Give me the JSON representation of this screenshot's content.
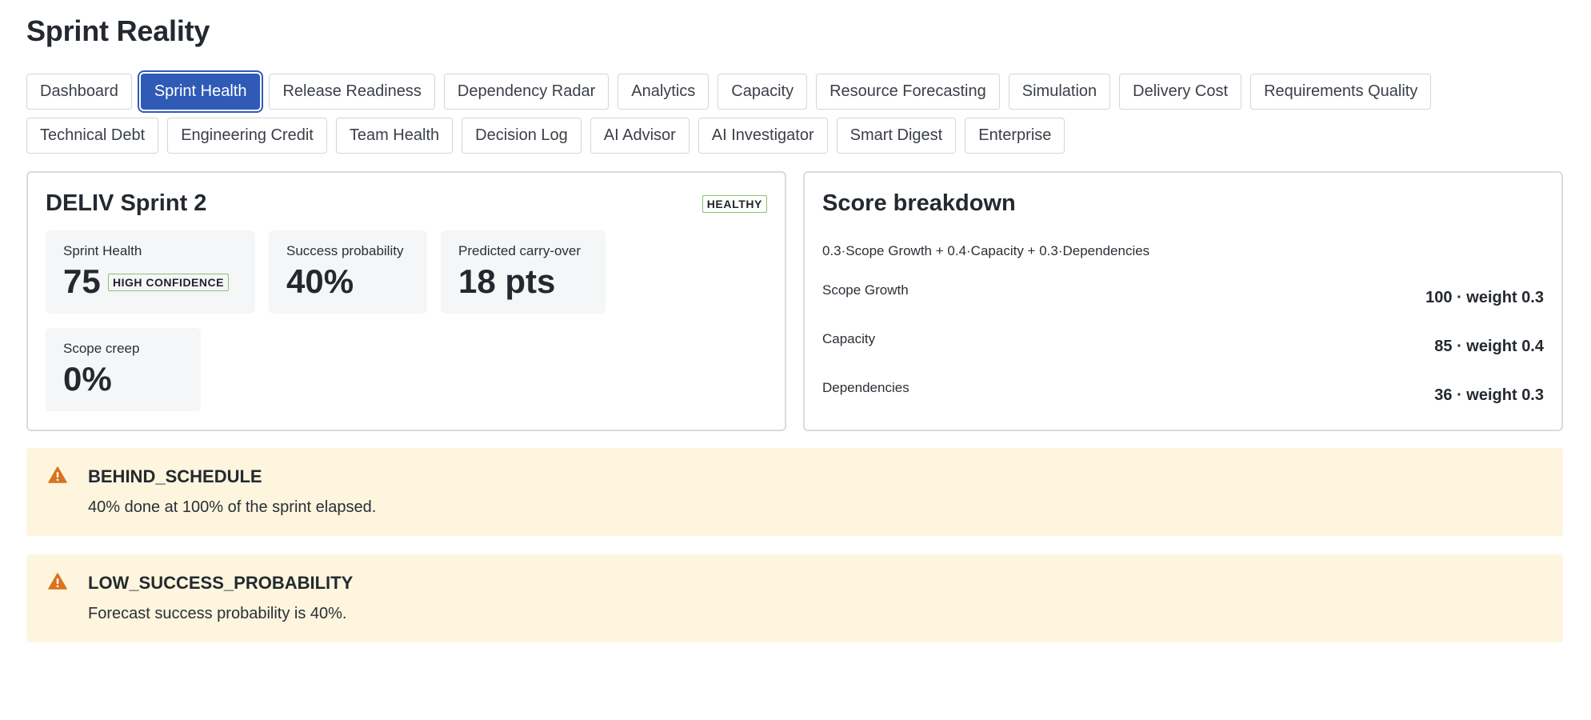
{
  "app": {
    "title": "Sprint Reality"
  },
  "tabs": {
    "row1": [
      "Dashboard",
      "Sprint Health",
      "Release Readiness",
      "Dependency Radar",
      "Analytics",
      "Capacity",
      "Resource Forecasting",
      "Simulation",
      "Delivery Cost",
      "Requirements Quality"
    ],
    "row2": [
      "Technical Debt",
      "Engineering Credit",
      "Team Health",
      "Decision Log",
      "AI Advisor",
      "AI Investigator",
      "Smart Digest",
      "Enterprise"
    ],
    "active": "Sprint Health"
  },
  "sprint": {
    "title": "DELIV Sprint 2",
    "status": "HEALTHY",
    "health_label": "Sprint Health",
    "health_value": "75",
    "confidence": "HIGH CONFIDENCE",
    "success_label": "Success probability",
    "success_value": "40%",
    "carry_label": "Predicted carry-over",
    "carry_value": "18 pts",
    "creep_label": "Scope creep",
    "creep_value": "0%"
  },
  "score": {
    "title": "Score breakdown",
    "formula": "0.3·Scope Growth + 0.4·Capacity + 0.3·Dependencies",
    "rows": [
      {
        "name": "Scope Growth",
        "value": "100 · weight 0.3"
      },
      {
        "name": "Capacity",
        "value": "85 · weight 0.4"
      },
      {
        "name": "Dependencies",
        "value": "36 · weight 0.3"
      }
    ]
  },
  "alerts": [
    {
      "icon": "warning-icon",
      "title": "BEHIND_SCHEDULE",
      "message": "40% done at 100% of the sprint elapsed."
    },
    {
      "icon": "warning-icon",
      "title": "LOW_SUCCESS_PROBABILITY",
      "message": "Forecast success probability is 40%."
    }
  ],
  "colors": {
    "accent": "#2f5bb7",
    "healthy_border": "#8cc270",
    "alert_bg": "#fdf5de",
    "warning_icon": "#d9731e"
  }
}
